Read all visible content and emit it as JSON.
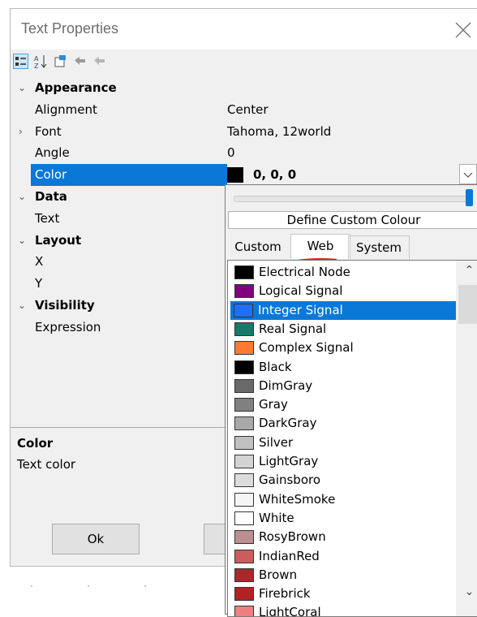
{
  "window": {
    "title": "Text Properties"
  },
  "toolbar": {
    "icons": [
      "categorized-icon",
      "sort-alphabetical-icon",
      "property-pages-icon",
      "events-icon",
      "disabled-events-icon"
    ]
  },
  "grid": {
    "rows": [
      {
        "kind": "category",
        "label": "Appearance",
        "expanded": true
      },
      {
        "kind": "prop",
        "label": "Alignment",
        "value": "Center"
      },
      {
        "kind": "prop",
        "label": "Font",
        "value": "Tahoma, 12world",
        "expandable": true
      },
      {
        "kind": "prop",
        "label": "Angle",
        "value": "0"
      },
      {
        "kind": "prop",
        "label": "Color",
        "value": "0, 0, 0",
        "selected": true,
        "swatch": "#000000"
      },
      {
        "kind": "category",
        "label": "Data",
        "expanded": true
      },
      {
        "kind": "prop",
        "label": "Text",
        "value": ""
      },
      {
        "kind": "category",
        "label": "Layout",
        "expanded": true
      },
      {
        "kind": "prop",
        "label": "X",
        "value": ""
      },
      {
        "kind": "prop",
        "label": "Y",
        "value": ""
      },
      {
        "kind": "category",
        "label": "Visibility",
        "expanded": true
      },
      {
        "kind": "prop",
        "label": "Expression",
        "value": ""
      }
    ]
  },
  "description": {
    "title": "Color",
    "text": "Text color"
  },
  "buttons": {
    "ok": "Ok"
  },
  "popup": {
    "slider_value_fraction": 1.0,
    "define_custom": "Define Custom Colour",
    "tabs": [
      "Custom",
      "Web",
      "System"
    ],
    "active_tab": "Web",
    "colors": [
      {
        "name": "Electrical Node",
        "hex": "#000000"
      },
      {
        "name": "Logical Signal",
        "hex": "#800080"
      },
      {
        "name": "Integer Signal",
        "hex": "#1e6fff",
        "selected": true
      },
      {
        "name": "Real Signal",
        "hex": "#147a6a"
      },
      {
        "name": "Complex Signal",
        "hex": "#ff7a30"
      },
      {
        "name": "Black",
        "hex": "#000000"
      },
      {
        "name": "DimGray",
        "hex": "#696969"
      },
      {
        "name": "Gray",
        "hex": "#808080"
      },
      {
        "name": "DarkGray",
        "hex": "#a9a9a9"
      },
      {
        "name": "Silver",
        "hex": "#c0c0c0"
      },
      {
        "name": "LightGray",
        "hex": "#d3d3d3"
      },
      {
        "name": "Gainsboro",
        "hex": "#dcdcdc"
      },
      {
        "name": "WhiteSmoke",
        "hex": "#f5f5f5"
      },
      {
        "name": "White",
        "hex": "#ffffff"
      },
      {
        "name": "RosyBrown",
        "hex": "#bc8f8f"
      },
      {
        "name": "IndianRed",
        "hex": "#cd5c5c"
      },
      {
        "name": "Brown",
        "hex": "#a52a2a"
      },
      {
        "name": "Firebrick",
        "hex": "#b22222"
      },
      {
        "name": "LightCoral",
        "hex": "#f08080"
      }
    ]
  },
  "colors": {
    "selection": "#0a78d7",
    "accent_underline": "#e02020"
  }
}
